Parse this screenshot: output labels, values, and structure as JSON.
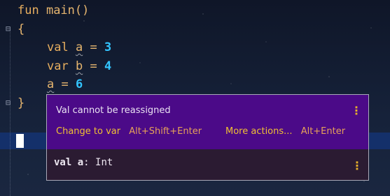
{
  "editor": {
    "lines": [
      {
        "kw": "fun",
        "rest": " main()"
      },
      {
        "text": "{"
      },
      {
        "kw": "val",
        "var": "a",
        "op": " = ",
        "num": "3"
      },
      {
        "kw": "var",
        "var": "b",
        "op": " = ",
        "num": "4"
      },
      {
        "var": "a",
        "op": " = ",
        "num": "6"
      },
      {
        "text": "}"
      }
    ]
  },
  "popup": {
    "message": "Val cannot be reassigned",
    "actions": [
      {
        "label": "Change to var",
        "shortcut": "Alt+Shift+Enter"
      },
      {
        "label": "More actions...",
        "shortcut": "Alt+Enter"
      }
    ],
    "signature": {
      "keyword": "val",
      "name": "a",
      "type": ": Int"
    }
  },
  "colors": {
    "popup_top_bg": "#4b0a88",
    "popup_bottom_bg": "#2b1b32",
    "action_label": "#f0c033",
    "number": "#33c5ff"
  }
}
